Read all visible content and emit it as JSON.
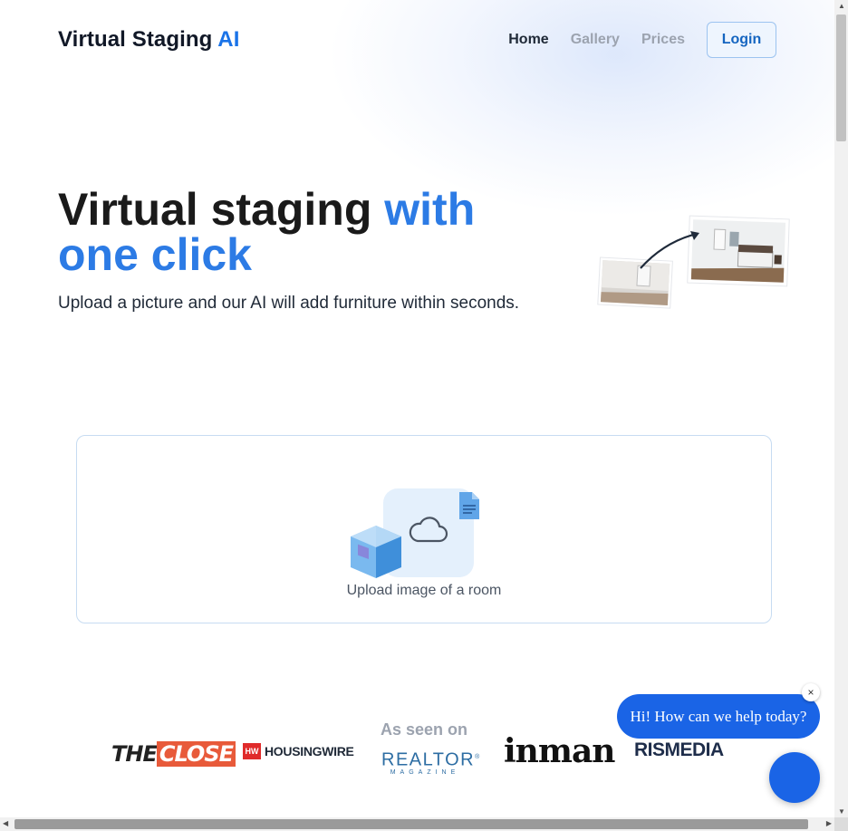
{
  "header": {
    "logo_text": "Virtual Staging ",
    "logo_accent": "AI",
    "nav": {
      "home": "Home",
      "gallery": "Gallery",
      "prices": "Prices"
    },
    "login_label": "Login"
  },
  "hero": {
    "title_main": "Virtual staging ",
    "title_accent": "with one click",
    "subtitle": "Upload a picture and our AI will add furniture within seconds."
  },
  "upload": {
    "label": "Upload image of a room",
    "icons": [
      "cloud-icon",
      "document-icon",
      "cube-icon"
    ]
  },
  "press": {
    "heading": "As seen on",
    "logos": {
      "theclose_the": "THE",
      "theclose_close": "CLOSE",
      "housingwire_mark": "HW",
      "housingwire_text": "HOUSINGWIRE",
      "realtor_main": "REALTOR",
      "realtor_sub": "MAGAZINE",
      "realtor_mark": "®",
      "inman": "inman",
      "rismedia": "RISMEDIA"
    }
  },
  "chat": {
    "message": "Hi! How can we help today?",
    "close_symbol": "×"
  },
  "colors": {
    "accent": "#2c7be5",
    "brand_blue": "#1a73e8",
    "chat_blue": "#1a64e6"
  }
}
